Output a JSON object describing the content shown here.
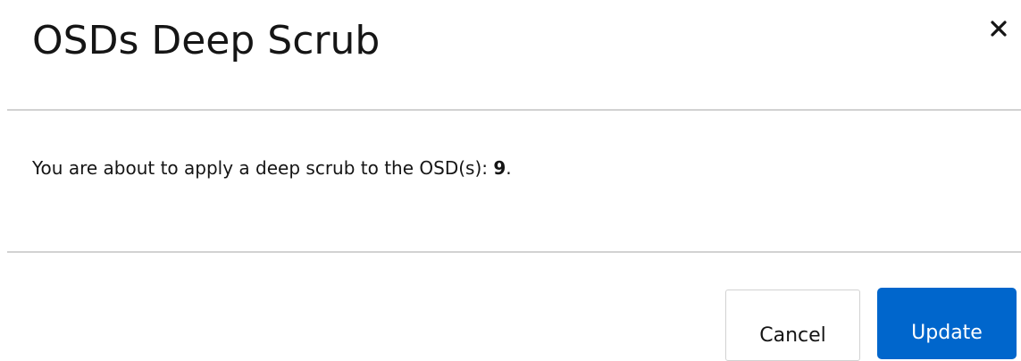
{
  "modal": {
    "title": "OSDs Deep Scrub",
    "close_icon": "close-icon",
    "body": {
      "message_prefix": "You are about to apply a deep scrub to the OSD(s): ",
      "osd_ids": "9",
      "message_suffix": "."
    },
    "footer": {
      "cancel_label": "Cancel",
      "update_label": "Update"
    }
  },
  "colors": {
    "primary": "#0066cc",
    "text": "#151515",
    "border": "#d2d2d2"
  }
}
